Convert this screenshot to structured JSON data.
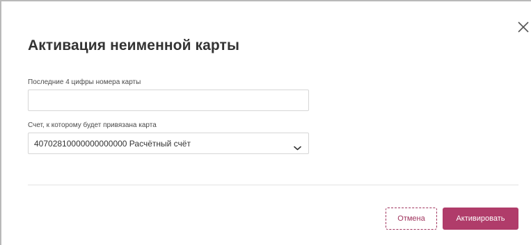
{
  "dialog": {
    "title": "Активация неименной карты",
    "close_icon": "close-icon"
  },
  "form": {
    "card_digits": {
      "label": "Последние 4 цифры номера карты",
      "value": "",
      "placeholder": ""
    },
    "account": {
      "label": "Счет, к которому будет привязана карта",
      "selected": "40702810000000000000 Расчётный счёт",
      "dropdown_icon": "chevron-down-icon"
    }
  },
  "actions": {
    "cancel_label": "Отмена",
    "activate_label": "Активировать"
  },
  "colors": {
    "accent": "#b03c6a",
    "text": "#333333",
    "border": "#d6d6d6"
  }
}
